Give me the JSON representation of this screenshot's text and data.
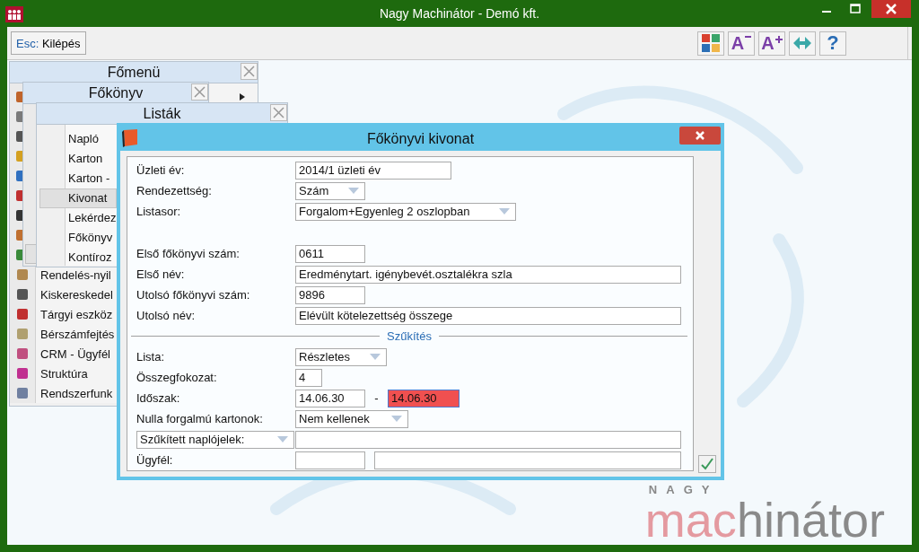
{
  "window": {
    "title": "Nagy Machinátor - Demó kft."
  },
  "toolbar": {
    "exit_button": {
      "key": "Esc:",
      "label": "Kilépés"
    },
    "tools": [
      {
        "kind": "tiles"
      },
      {
        "kind": "font_smaller",
        "glyph": "A"
      },
      {
        "kind": "font_larger",
        "glyph": "A"
      },
      {
        "kind": "arrows"
      },
      {
        "kind": "help",
        "glyph": "?"
      }
    ]
  },
  "main_menu": {
    "title": "Főmenü",
    "items": [
      {
        "label": "Rendelés-nyil"
      },
      {
        "label": "Kiskereskedel"
      },
      {
        "label": "Tárgyi eszköz"
      },
      {
        "label": "Bérszámfejtés"
      },
      {
        "label": "CRM - Ügyfél"
      },
      {
        "label": "Struktúra"
      },
      {
        "label": "Rendszerfunk"
      }
    ]
  },
  "ledger_menu": {
    "title": "Főkönyv"
  },
  "lists_menu": {
    "title": "Listák",
    "items": [
      {
        "label": "Napló",
        "selected": false
      },
      {
        "label": "Karton",
        "selected": false
      },
      {
        "label": "Karton -",
        "selected": false
      },
      {
        "label": "Kivonat",
        "selected": true
      },
      {
        "label": "Lekérdez",
        "selected": false
      },
      {
        "label": "Főkönyv",
        "selected": false
      },
      {
        "label": "Kontíroz",
        "selected": false
      }
    ]
  },
  "dialog": {
    "title": "Főkönyvi kivonat",
    "rows_a": [
      {
        "kind": "text",
        "label": "Üzleti év:",
        "value": "2014/1 üzleti év"
      },
      {
        "kind": "select",
        "label": "Rendezettség:",
        "value": "Szám"
      },
      {
        "kind": "select",
        "label": "Listasor:",
        "value": "Forgalom+Egyenleg 2 oszlopban"
      }
    ],
    "rows_b": [
      {
        "kind": "text",
        "label": "Első főkönyvi szám:",
        "value": "0611"
      },
      {
        "kind": "text",
        "label": "Első név:",
        "value": "Eredménytart. igénybevét.osztalékra szla"
      },
      {
        "kind": "text",
        "label": "Utolsó főkönyvi szám:",
        "value": "9896"
      },
      {
        "kind": "text",
        "label": "Utolsó név:",
        "value": "Elévült kötelezettség összege"
      }
    ],
    "filter_title": "Szűkítés",
    "filter_rows": [
      {
        "kind": "select",
        "label": "Lista:",
        "value": "Részletes"
      },
      {
        "kind": "text",
        "label": "Összegfokozat:",
        "value": "4"
      },
      {
        "kind": "range",
        "label": "Időszak:",
        "from": "14.06.30",
        "separator": "-",
        "to": "14.06.30",
        "invalid": true
      },
      {
        "kind": "select",
        "label": "Nulla forgalmú kartonok:",
        "value": "Nem kellenek"
      },
      {
        "kind": "select_label",
        "label": "Szűkített naplójelek:"
      },
      {
        "kind": "pair",
        "label": "Ügyfél:"
      }
    ]
  },
  "logo": {
    "top": "NAGY",
    "first": "mac",
    "rest": "hinátor"
  }
}
